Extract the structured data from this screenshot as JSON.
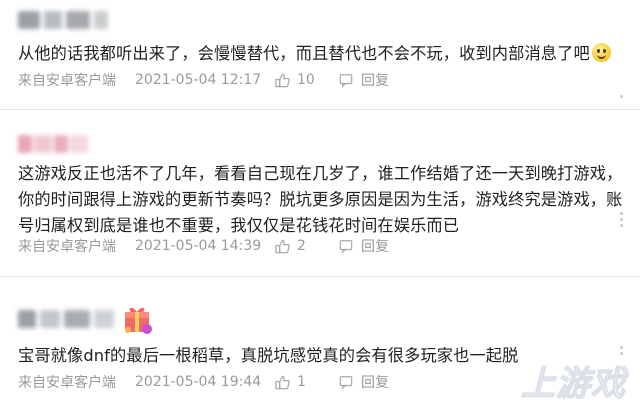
{
  "comments": [
    {
      "text": "从他的话我都听出来了，会慢慢替代，而且替代也不会不玩，收到内部消息了吧",
      "source": "来自安卓客户端",
      "time": "2021-05-04 12:17",
      "likes": "10",
      "reply_label": "回复"
    },
    {
      "text": "这游戏反正也活不了几年，看看自己现在几岁了，谁工作结婚了还一天到晚打游戏，你的时间跟得上游戏的更新节奏吗？脱坑更多原因是因为生活，游戏终究是游戏，账号归属权到底是谁也不重要，我仅仅是花钱花时间在娱乐而已",
      "source": "来自安卓客户端",
      "time": "2021-05-04 14:39",
      "likes": "2",
      "reply_label": "回复"
    },
    {
      "text": "宝哥就像dnf的最后一根稻草，真脱坑感觉真的会有很多玩家也一起脱",
      "source": "来自安卓客户端",
      "time": "2021-05-04 19:44",
      "likes": "1",
      "reply_label": "回复"
    }
  ],
  "colors": {
    "meta_text": "#9a9a9a",
    "divider": "#e6e6e6"
  },
  "icons": [
    "thumbs-up-icon",
    "reply-icon",
    "smile-emoji-icon",
    "gift-badge-icon",
    "more-dots-icon"
  ]
}
